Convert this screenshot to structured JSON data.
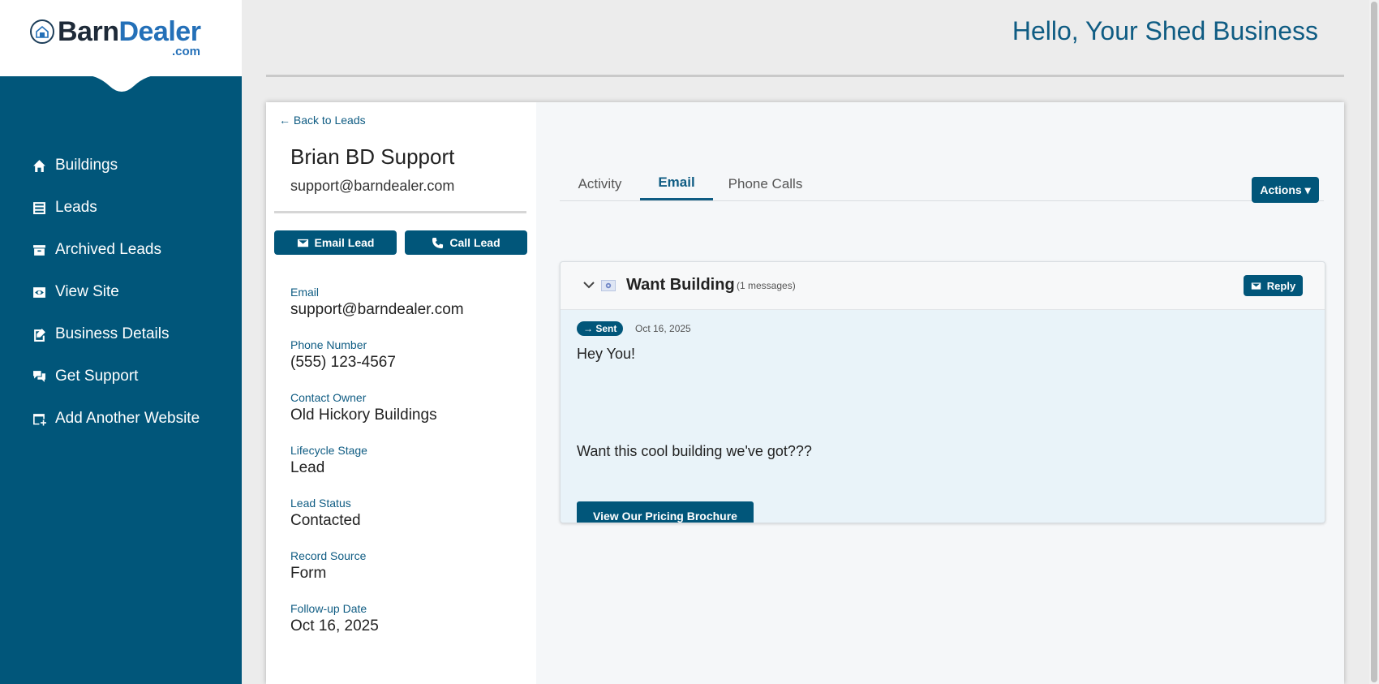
{
  "brand": {
    "name_part1": "Barn",
    "name_part2": "Dealer",
    "tld": ".com"
  },
  "sidebar": {
    "items": [
      {
        "label": "Buildings",
        "icon": "home-icon"
      },
      {
        "label": "Leads",
        "icon": "list-icon"
      },
      {
        "label": "Archived Leads",
        "icon": "archive-icon"
      },
      {
        "label": "View Site",
        "icon": "eye-icon"
      },
      {
        "label": "Business Details",
        "icon": "edit-document-icon"
      },
      {
        "label": "Get Support",
        "icon": "chat-icon"
      },
      {
        "label": "Add Another Website",
        "icon": "add-window-icon"
      }
    ]
  },
  "header": {
    "greeting": "Hello, Your Shed Business"
  },
  "lead": {
    "back_label": "← Back to Leads",
    "name": "Brian BD Support",
    "email": "support@barndealer.com",
    "email_button": "Email Lead",
    "call_button": "Call Lead",
    "fields": [
      {
        "label": "Email",
        "value": "support@barndealer.com"
      },
      {
        "label": "Phone Number",
        "value": "(555) 123-4567"
      },
      {
        "label": "Contact Owner",
        "value": "Old Hickory Buildings"
      },
      {
        "label": "Lifecycle Stage",
        "value": "Lead"
      },
      {
        "label": "Lead Status",
        "value": "Contacted"
      },
      {
        "label": "Record Source",
        "value": "Form"
      },
      {
        "label": "Follow-up Date",
        "value": "Oct 16, 2025"
      }
    ]
  },
  "tabs": [
    {
      "label": "Activity"
    },
    {
      "label": "Email",
      "active": true
    },
    {
      "label": "Phone Calls"
    }
  ],
  "actions_label": "Actions ▾",
  "thread": {
    "subject": "Want Building",
    "count": "(1 messages)",
    "reply_label": "Reply",
    "message": {
      "badge": "→ Sent",
      "date": "Oct 16, 2025",
      "line1": "Hey You!",
      "line2": "Want this cool building we've got???",
      "button": "View Our Pricing Brochure"
    }
  },
  "colors": {
    "primary": "#01567a",
    "accent_text": "#0f5c83",
    "brand_blue": "#2470b8"
  }
}
